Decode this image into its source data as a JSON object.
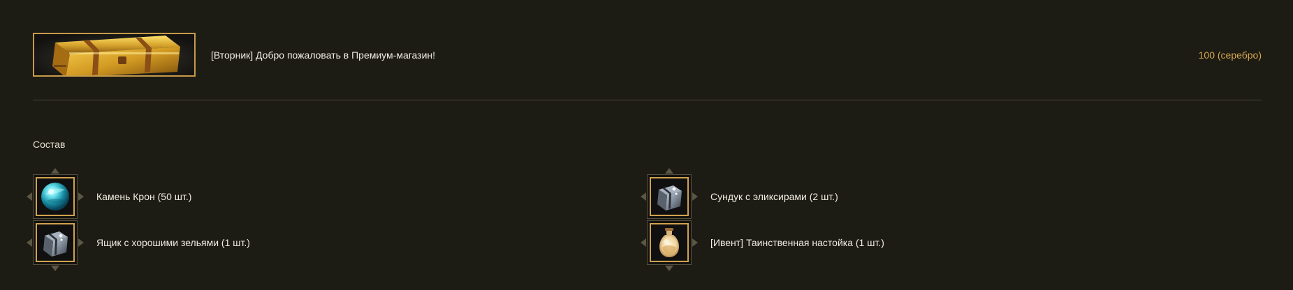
{
  "header": {
    "title": "[Вторник] Добро пожаловать в Премиум-магазин!",
    "price": "100 (серебро)",
    "image_icon": "golden-chest-icon"
  },
  "composition": {
    "title": "Состав",
    "items": [
      {
        "label": "Камень Крон (50 шт.)",
        "icon": "crown-stone-icon"
      },
      {
        "label": "Ящик с хорошими зельями (1 шт.)",
        "icon": "potion-chest-icon"
      },
      {
        "label": "Сундук с эликсирами (2 шт.)",
        "icon": "elixir-chest-icon"
      },
      {
        "label": "[Ивент] Таинственная настойка (1 шт.)",
        "icon": "mysterious-tincture-icon"
      }
    ]
  },
  "colors": {
    "background": "#1c1b14",
    "gold_border": "#d0a24f",
    "price_text": "#d9a84e",
    "divider": "#4a463a"
  }
}
